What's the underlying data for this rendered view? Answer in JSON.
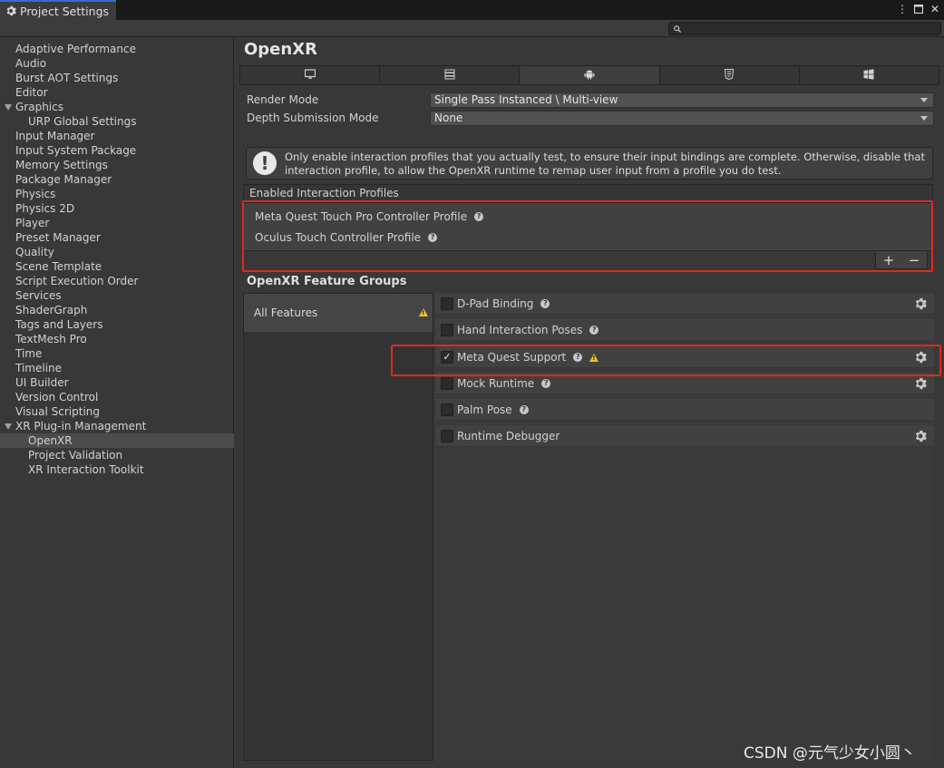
{
  "window": {
    "title": "Project Settings"
  },
  "search": {
    "value": ""
  },
  "sidebar": {
    "items": [
      {
        "label": "Adaptive Performance"
      },
      {
        "label": "Audio"
      },
      {
        "label": "Burst AOT Settings"
      },
      {
        "label": "Editor"
      },
      {
        "label": "Graphics"
      },
      {
        "label": "URP Global Settings"
      },
      {
        "label": "Input Manager"
      },
      {
        "label": "Input System Package"
      },
      {
        "label": "Memory Settings"
      },
      {
        "label": "Package Manager"
      },
      {
        "label": "Physics"
      },
      {
        "label": "Physics 2D"
      },
      {
        "label": "Player"
      },
      {
        "label": "Preset Manager"
      },
      {
        "label": "Quality"
      },
      {
        "label": "Scene Template"
      },
      {
        "label": "Script Execution Order"
      },
      {
        "label": "Services"
      },
      {
        "label": "ShaderGraph"
      },
      {
        "label": "Tags and Layers"
      },
      {
        "label": "TextMesh Pro"
      },
      {
        "label": "Time"
      },
      {
        "label": "Timeline"
      },
      {
        "label": "UI Builder"
      },
      {
        "label": "Version Control"
      },
      {
        "label": "Visual Scripting"
      },
      {
        "label": "XR Plug-in Management"
      },
      {
        "label": "OpenXR"
      },
      {
        "label": "Project Validation"
      },
      {
        "label": "XR Interaction Toolkit"
      }
    ],
    "selected": "OpenXR"
  },
  "main": {
    "title": "OpenXR",
    "platform_tabs": [
      "desktop-icon",
      "server-icon",
      "android-icon",
      "html5-icon",
      "windows-icon"
    ],
    "active_tab": "android-icon",
    "render_mode": {
      "label": "Render Mode",
      "value": "Single Pass Instanced \\ Multi-view"
    },
    "depth_submission": {
      "label": "Depth Submission Mode",
      "value": "None"
    },
    "help_text": "Only enable interaction profiles that you actually test, to ensure their input bindings are complete. Otherwise, disable that interaction profile, to allow the OpenXR runtime to remap user input from a profile you do test.",
    "profiles": {
      "header": "Enabled Interaction Profiles",
      "items": [
        {
          "label": "Meta Quest Touch Pro Controller Profile"
        },
        {
          "label": "Oculus Touch Controller Profile"
        }
      ],
      "add": "+",
      "remove": "−"
    },
    "feature_groups": {
      "title": "OpenXR Feature Groups",
      "groups": [
        {
          "label": "All Features"
        }
      ],
      "features": [
        {
          "label": "D-Pad Binding",
          "checked": false
        },
        {
          "label": "Hand Interaction Poses",
          "checked": false
        },
        {
          "label": "Meta Quest Support",
          "checked": true
        },
        {
          "label": "Mock Runtime",
          "checked": false
        },
        {
          "label": "Palm Pose",
          "checked": false
        },
        {
          "label": "Runtime Debugger",
          "checked": false
        }
      ]
    }
  },
  "watermark": "CSDN @元气少女小圆丶",
  "colors": {
    "highlight_box": "#e0281e",
    "warning": "#f2c230",
    "accent_tab": "#2f6fd0"
  }
}
